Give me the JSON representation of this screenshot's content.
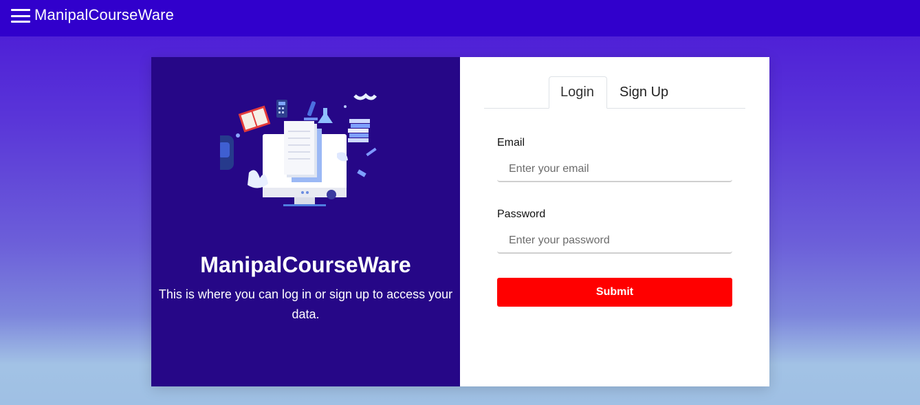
{
  "header": {
    "brand": "ManipalCourseWare",
    "menu_icon": "hamburger-menu-icon",
    "background": "#3100cc"
  },
  "left_panel": {
    "title": "ManipalCourseWare",
    "description": "This is where you can log in or sign up to access your data.",
    "illustration": "education-illustration",
    "background": "#260787"
  },
  "auth": {
    "tabs": [
      {
        "label": "Login",
        "active": true
      },
      {
        "label": "Sign Up",
        "active": false
      }
    ],
    "email": {
      "label": "Email",
      "placeholder": "Enter your email",
      "value": ""
    },
    "password": {
      "label": "Password",
      "placeholder": "Enter your password",
      "value": ""
    },
    "submit_label": "Submit",
    "submit_color": "#ff0000"
  }
}
